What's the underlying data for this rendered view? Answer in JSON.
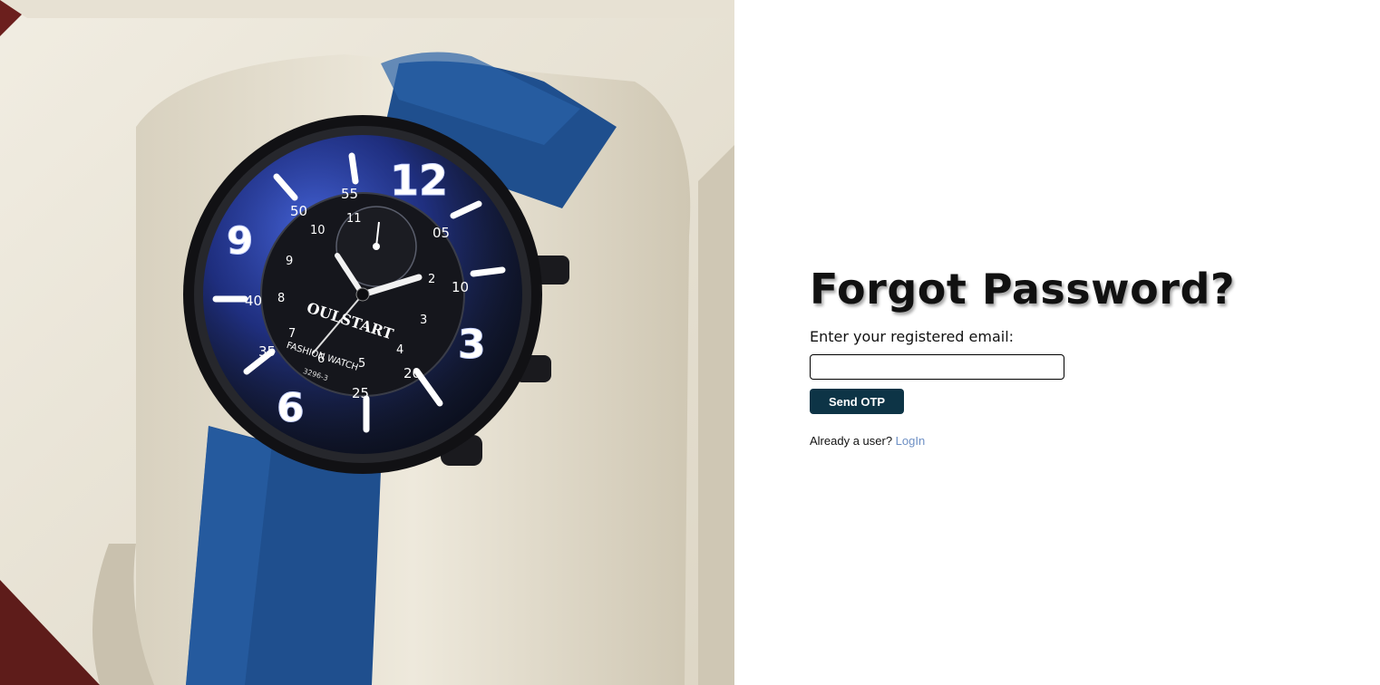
{
  "form": {
    "title": "Forgot Password?",
    "email_label": "Enter your registered email:",
    "email_value": "",
    "email_placeholder": "",
    "send_button_label": "Send OTP",
    "already_text": "Already a user? ",
    "login_link_label": "LogIn"
  },
  "hero": {
    "brand": "OULSTART",
    "dial_text": "FASHION  WATCH",
    "model": "3296-3"
  },
  "colors": {
    "button_bg": "#0d3446",
    "link": "#6d8fc4",
    "strap": "#1f4f8e"
  }
}
